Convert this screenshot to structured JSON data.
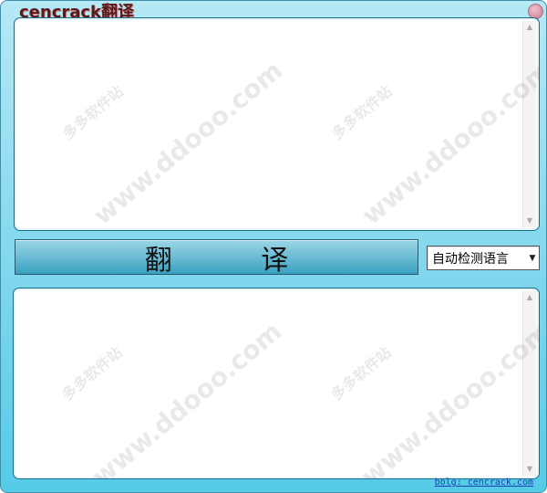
{
  "window": {
    "title": "cencrack翻译"
  },
  "translate_button": {
    "label": "翻  译"
  },
  "language_selector": {
    "selected": "自动检测语言"
  },
  "input_pane": {
    "value": ""
  },
  "output_pane": {
    "value": ""
  },
  "watermark": {
    "text_cn": "多多软件站",
    "text_url": "www.ddooo.com"
  },
  "footer": {
    "link_text": "bolg: cencrack.com"
  },
  "colors": {
    "window_top": "#b6e9f6",
    "window_bottom": "#55cbe8",
    "title_color": "#5a1a1a",
    "link_color": "#1a3fb0"
  }
}
